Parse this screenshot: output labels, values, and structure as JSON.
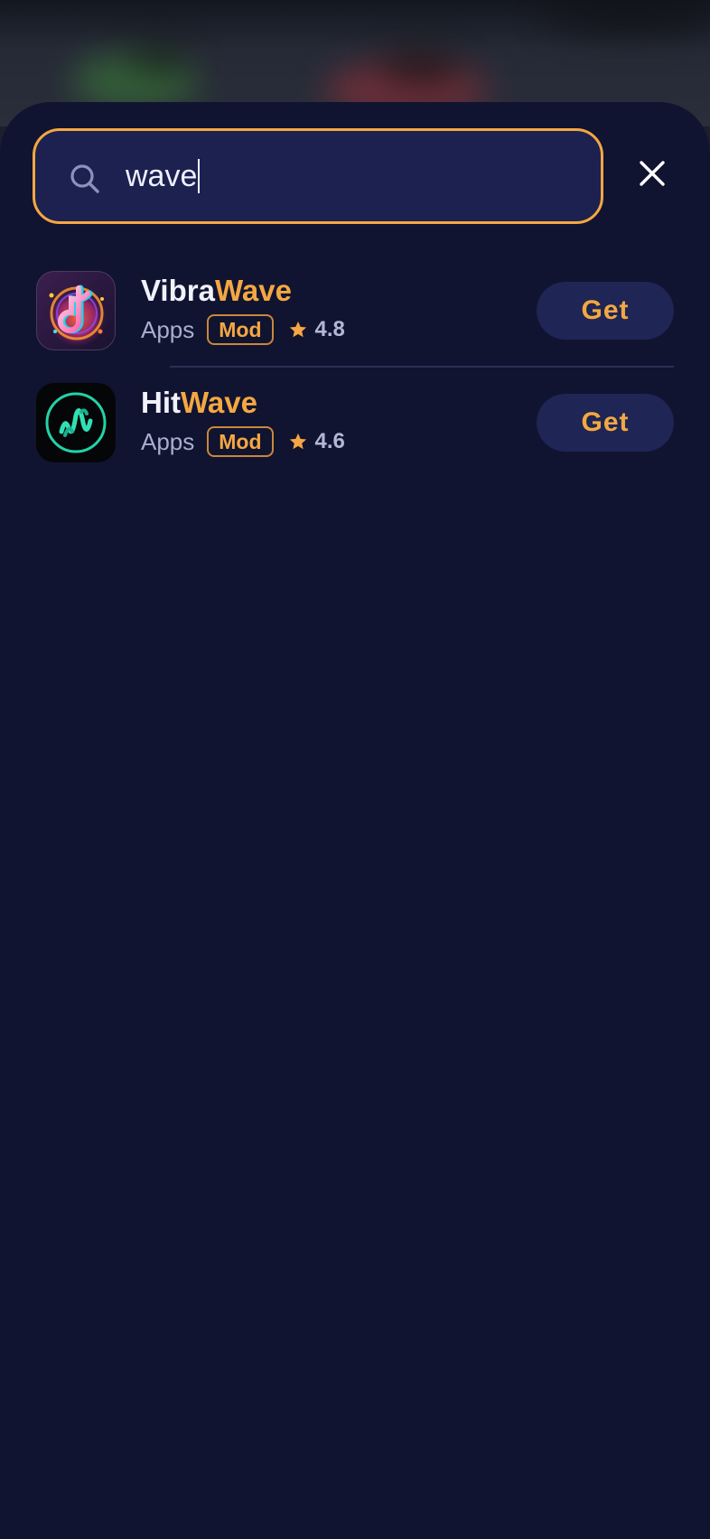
{
  "search": {
    "value": "wave",
    "close_label": "×"
  },
  "results": [
    {
      "name_prefix": "Vibra",
      "name_highlight": "Wave",
      "category": "Apps",
      "badge": "Mod",
      "rating": "4.8",
      "action": "Get",
      "icon": "music-note-icon"
    },
    {
      "name_prefix": "Hit",
      "name_highlight": "Wave",
      "category": "Apps",
      "badge": "Mod",
      "rating": "4.6",
      "action": "Get",
      "icon": "sound-wave-icon"
    }
  ],
  "colors": {
    "accent": "#f4a742",
    "sheet_background": "#111430",
    "search_background": "#1c2150",
    "button_background": "#1f2554"
  }
}
